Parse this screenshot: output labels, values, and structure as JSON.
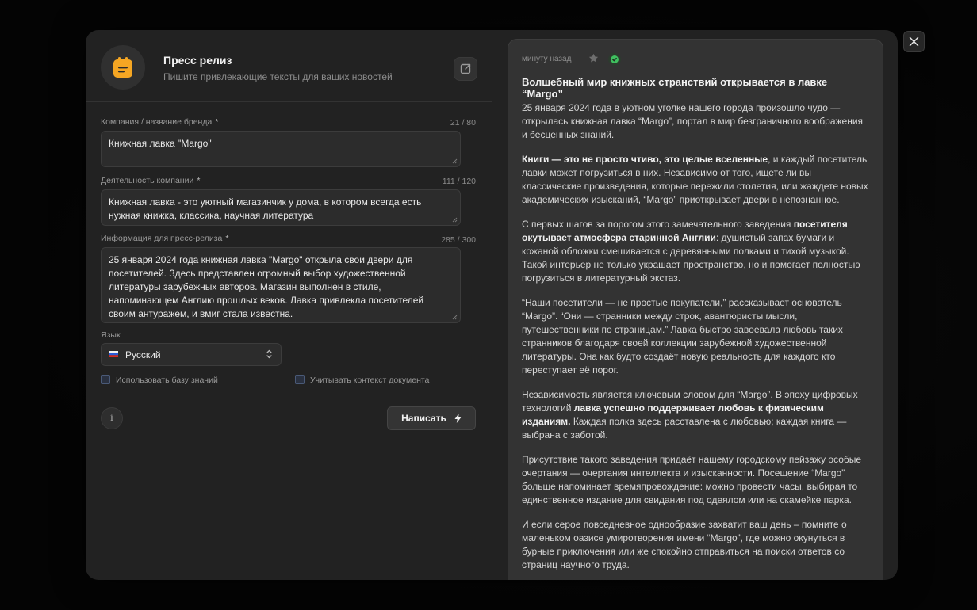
{
  "header": {
    "title": "Пресс релиз",
    "subtitle": "Пишите привлекающие тексты для ваших новостей"
  },
  "form": {
    "company": {
      "label": "Компания / название бренда",
      "required": "*",
      "counter": "21 / 80",
      "value": "Книжная лавка \"Margo\""
    },
    "activity": {
      "label": "Деятельность компании",
      "required": "*",
      "counter": "111 / 120",
      "value": "Книжная лавка - это уютный магазинчик у дома, в котором всегда есть нужная книжка, классика, научная литература"
    },
    "info": {
      "label": "Информация для пресс-релиза",
      "required": "*",
      "counter": "285 / 300",
      "value": "25 января 2024 года книжная лавка \"Margo\" открыла свои двери для посетителей. Здесь представлен огромный выбор художественной литературы зарубежных авторов. Магазин выполнен в стиле, напоминающем Англию прошлых веков. Лавка привлекла посетителей своим антуражем, и вмиг стала известна."
    },
    "language": {
      "label": "Язык",
      "value": "Русский"
    },
    "checkbox_kb": {
      "label": "Использовать базу знаний",
      "checked": false
    },
    "checkbox_ctx": {
      "label": "Учитывать контекст документа",
      "checked": false
    },
    "info_icon": "i",
    "write_button": "Написать"
  },
  "result": {
    "timestamp": "минуту назад",
    "title": "Волшебный мир книжных странствий открывается в лавке “Margo”",
    "p1": "25 января 2024 года в уютном уголке нашего города произошло чудо — открылась книжная лавка “Margo”, портал в мир безграничного воображения и бесценных знаний.",
    "p2_bold": "Книги — это не просто чтиво, это целые вселенные",
    "p2_rest": ", и каждый посетитель лавки может погрузиться в них. Независимо от того, ищете ли вы классические произведения, которые пережили столетия, или жаждете новых академических изысканий, “Margo” приоткрывает двери в непознанное.",
    "p3_a": "С первых шагов за порогом этого замечательного заведения ",
    "p3_bold": "посетителя окутывает атмосфера старинной Англии",
    "p3_rest": ": душистый запах бумаги и кожаной обложки смешивается с деревянными полками и тихой музыкой. Такой интерьер не только украшает пространство, но и помогает полностью погрузиться в литературный экстаз.",
    "p4": "“Наши посетители — не простые покупатели,” рассказывает основатель “Margo”. “Они — странники между строк, авантюристы мысли, путешественники по страницам.” Лавка быстро завоевала любовь таких странников благодаря своей коллекции зарубежной художественной литературы. Она как будто создаёт новую реальность для каждого кто переступает её порог.",
    "p5_a": "Независимость является ключевым словом для “Margo”. В эпоху цифровых технологий ",
    "p5_bold": "лавка успешно поддерживает любовь к физическим изданиям.",
    "p5_rest": " Каждая полка здесь расставлена с любовью; каждая книга — выбрана с заботой.",
    "p6": "Присутствие такого заведения придаёт нашему городскому пейзажу особые очертания — очертания интеллекта и изысканности. Посещение “Margo” больше напоминает времяпровождение: можно провести часы, выбирая то единственное издание для свидания под одеялом или на скамейке парка.",
    "p7": "И если серое повседневное однообразие захватит ваш день – помните о маленьком оазисе умиротворения имени “Margo”, где можно окунуться в бурные приключения или же спокойно отправиться на поиски ответов со страниц научного труда."
  },
  "colors": {
    "accent": "#f5a623",
    "success": "#3fbf5f",
    "checkbox_border": "#4a5a78"
  },
  "icons": [
    "calendar-icon",
    "share-icon",
    "chevron-updown-icon",
    "flag-ru-icon",
    "info-icon",
    "bolt-icon",
    "star-icon",
    "check-icon",
    "close-icon"
  ]
}
